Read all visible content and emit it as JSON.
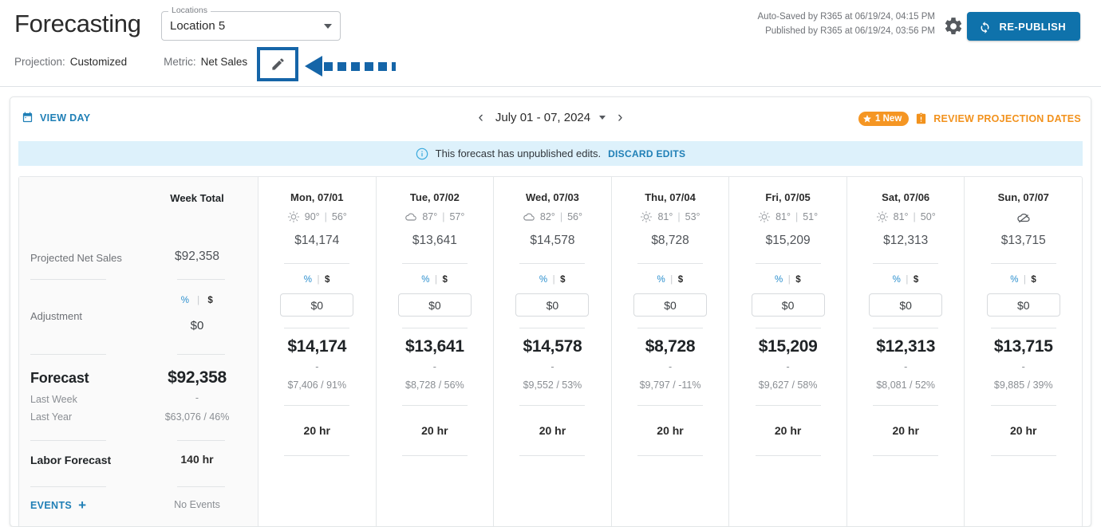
{
  "header": {
    "title": "Forecasting",
    "locations_label": "Locations",
    "locations_value": "Location 5",
    "projection_label": "Projection:",
    "projection_value": "Customized",
    "metric_label": "Metric:",
    "metric_value": "Net Sales",
    "autosaved": "Auto-Saved by R365 at 06/19/24, 04:15 PM",
    "published": "Published by R365 at 06/19/24, 03:56 PM",
    "republish_label": "RE-PUBLISH",
    "accent_blue": "#0f72ab",
    "annotation_blue": "#1565a8"
  },
  "toolbar": {
    "view_day": "VIEW DAY",
    "date_range": "July 01 - 07, 2024",
    "prev": "‹",
    "next": "›",
    "badge_new": "1 New",
    "review_link": "REVIEW PROJECTION DATES",
    "review_color": "#f2921d"
  },
  "banner": {
    "message": "This forecast has unpublished edits.",
    "action": "DISCARD EDITS",
    "bg": "#ddf1fb"
  },
  "rows": {
    "projected": "Projected Net Sales",
    "adjustment": "Adjustment",
    "forecast": "Forecast",
    "last_week": "Last Week",
    "last_year": "Last Year",
    "labor": "Labor Forecast",
    "events": "EVENTS",
    "events_plus": "+"
  },
  "toggle": {
    "pct": "%",
    "sep": "|",
    "dollar": "$"
  },
  "week_total": {
    "header": "Week Total",
    "projected": "$92,358",
    "adjustment": "$0",
    "forecast": "$92,358",
    "last_week": "-",
    "last_year": "$63,076 / 46%",
    "labor": "140 hr",
    "events": "No Events"
  },
  "days": [
    {
      "name": "Mon, 07/01",
      "weather_icon": "sun-icon",
      "high": "90°",
      "low": "56°",
      "projected": "$14,174",
      "adjustment": "$0",
      "forecast": "$14,174",
      "last_week": "-",
      "last_year": "$7,406 / 91%",
      "labor": "20 hr"
    },
    {
      "name": "Tue, 07/02",
      "weather_icon": "cloud-icon",
      "high": "87°",
      "low": "57°",
      "projected": "$13,641",
      "adjustment": "$0",
      "forecast": "$13,641",
      "last_week": "-",
      "last_year": "$8,728 / 56%",
      "labor": "20 hr"
    },
    {
      "name": "Wed, 07/03",
      "weather_icon": "cloud-icon",
      "high": "82°",
      "low": "56°",
      "projected": "$14,578",
      "adjustment": "$0",
      "forecast": "$14,578",
      "last_week": "-",
      "last_year": "$9,552 / 53%",
      "labor": "20 hr"
    },
    {
      "name": "Thu, 07/04",
      "weather_icon": "sun-icon",
      "high": "81°",
      "low": "53°",
      "projected": "$8,728",
      "adjustment": "$0",
      "forecast": "$8,728",
      "last_week": "-",
      "last_year": "$9,797 / -11%",
      "labor": "20 hr"
    },
    {
      "name": "Fri, 07/05",
      "weather_icon": "sun-icon",
      "high": "81°",
      "low": "51°",
      "projected": "$15,209",
      "adjustment": "$0",
      "forecast": "$15,209",
      "last_week": "-",
      "last_year": "$9,627 / 58%",
      "labor": "20 hr"
    },
    {
      "name": "Sat, 07/06",
      "weather_icon": "sun-icon",
      "high": "81°",
      "low": "50°",
      "projected": "$12,313",
      "adjustment": "$0",
      "forecast": "$12,313",
      "last_week": "-",
      "last_year": "$8,081 / 52%",
      "labor": "20 hr"
    },
    {
      "name": "Sun, 07/07",
      "weather_icon": "cloud-off-icon",
      "high": "",
      "low": "",
      "projected": "$13,715",
      "adjustment": "$0",
      "forecast": "$13,715",
      "last_week": "-",
      "last_year": "$9,885 / 39%",
      "labor": "20 hr"
    }
  ]
}
